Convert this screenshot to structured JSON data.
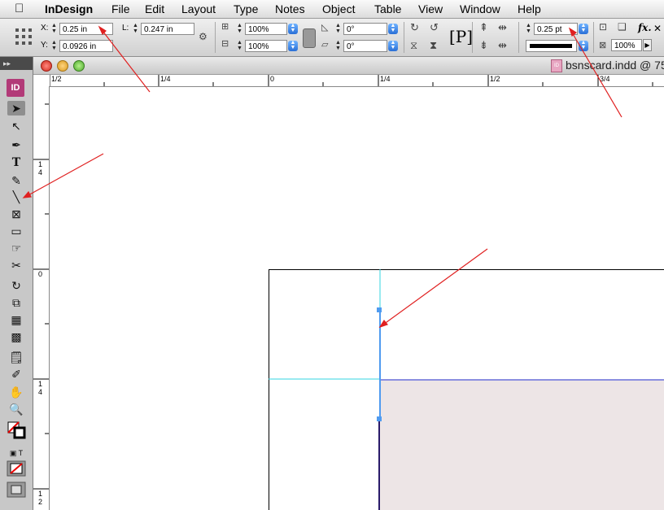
{
  "menubar": {
    "app_name": "InDesign",
    "items": [
      "File",
      "Edit",
      "Layout",
      "Type",
      "Notes",
      "Object",
      "Table",
      "View",
      "Window",
      "Help"
    ]
  },
  "control": {
    "x_label": "X:",
    "x_value": "0.25 in",
    "y_label": "Y:",
    "y_value": "0.0926 in",
    "l_label": "L:",
    "l_value": "0.247 in",
    "scale_x": "100%",
    "scale_y": "100%",
    "rotate": "0°",
    "shear": "0°",
    "stroke_weight": "0.25 pt",
    "opacity": "100%",
    "fx_label": "fx."
  },
  "tools_panel": {
    "logo": "ID"
  },
  "document": {
    "title": "bsnscard.indd @ 75"
  },
  "rulers": {
    "horizontal": [
      "1/2",
      "1/4",
      "0",
      "1/4",
      "1/2",
      "3/4"
    ],
    "vertical_top_fraction": [
      "1",
      "4"
    ],
    "vertical_zero": "0",
    "vertical_mid_fraction": [
      "1",
      "4"
    ],
    "vertical_bottom_fraction": [
      "1",
      "2"
    ]
  },
  "colors": {
    "accent": "#b23a78",
    "guide_cyan": "#33d6e0",
    "selection_blue": "#4f9bf0",
    "frame_fill": "#ede5e6",
    "annotation_red": "#e02020"
  }
}
